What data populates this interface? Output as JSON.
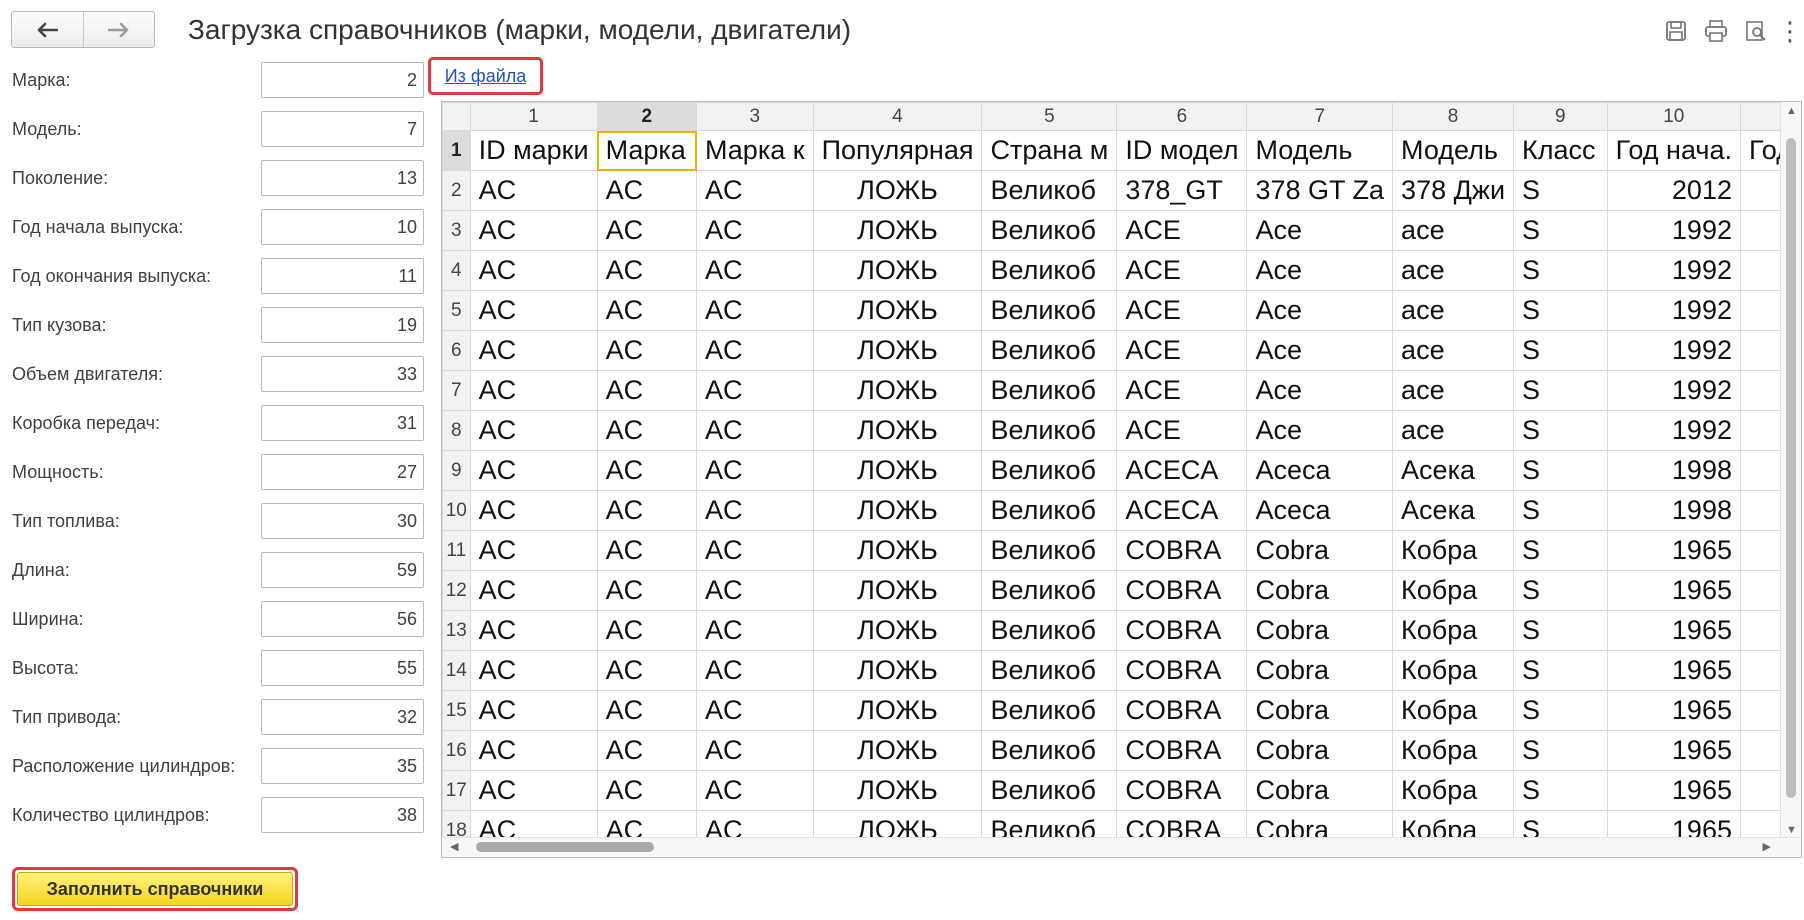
{
  "window": {
    "title": "Загрузка справочников (марки, модели, двигатели)"
  },
  "nav": {
    "back_icon": "arrow-left-icon",
    "forward_icon": "arrow-right-icon"
  },
  "toolbar": {
    "icons": [
      "save-icon",
      "print-icon",
      "preview-icon",
      "more-icon"
    ],
    "more_label": "⋮"
  },
  "fields": [
    {
      "label": "Марка:",
      "value": "2"
    },
    {
      "label": "Модель:",
      "value": "7"
    },
    {
      "label": "Поколение:",
      "value": "13"
    },
    {
      "label": "Год начала выпуска:",
      "value": "10"
    },
    {
      "label": "Год окончания выпуска:",
      "value": "11"
    },
    {
      "label": "Тип кузова:",
      "value": "19"
    },
    {
      "label": "Объем двигателя:",
      "value": "33"
    },
    {
      "label": "Коробка передач:",
      "value": "31"
    },
    {
      "label": "Мощность:",
      "value": "27"
    },
    {
      "label": "Тип топлива:",
      "value": "30"
    },
    {
      "label": "Длина:",
      "value": "59"
    },
    {
      "label": "Ширина:",
      "value": "56"
    },
    {
      "label": "Высота:",
      "value": "55"
    },
    {
      "label": "Тип привода:",
      "value": "32"
    },
    {
      "label": "Расположение цилиндров:",
      "value": "35"
    },
    {
      "label": "Количество цилиндров:",
      "value": "38"
    }
  ],
  "links": {
    "from_file": "Из файла"
  },
  "buttons": {
    "fill": "Заполнить справочники"
  },
  "sheet": {
    "column_numbers": [
      "1",
      "2",
      "3",
      "4",
      "5",
      "6",
      "7",
      "8",
      "9",
      "10",
      ""
    ],
    "rows": [
      {
        "n": "1",
        "cells": [
          "ID марки",
          "Марка",
          "Марка к",
          "Популярная",
          "Страна м",
          "ID модел",
          "Модель",
          "Модель",
          "Класс",
          "Год нача.",
          "Год"
        ]
      },
      {
        "n": "2",
        "cells": [
          "AC",
          "AC",
          "AC",
          "ЛОЖЬ",
          "Великоб",
          "378_GT",
          "378 GT Za",
          "378 Джи",
          "S",
          "2012",
          ""
        ]
      },
      {
        "n": "3",
        "cells": [
          "AC",
          "AC",
          "AC",
          "ЛОЖЬ",
          "Великоб",
          "ACE",
          "Ace",
          "асе",
          "S",
          "1992",
          ""
        ]
      },
      {
        "n": "4",
        "cells": [
          "AC",
          "AC",
          "AC",
          "ЛОЖЬ",
          "Великоб",
          "ACE",
          "Ace",
          "асе",
          "S",
          "1992",
          ""
        ]
      },
      {
        "n": "5",
        "cells": [
          "AC",
          "AC",
          "AC",
          "ЛОЖЬ",
          "Великоб",
          "ACE",
          "Ace",
          "асе",
          "S",
          "1992",
          ""
        ]
      },
      {
        "n": "6",
        "cells": [
          "AC",
          "AC",
          "AC",
          "ЛОЖЬ",
          "Великоб",
          "ACE",
          "Ace",
          "асе",
          "S",
          "1992",
          ""
        ]
      },
      {
        "n": "7",
        "cells": [
          "AC",
          "AC",
          "AC",
          "ЛОЖЬ",
          "Великоб",
          "ACE",
          "Ace",
          "асе",
          "S",
          "1992",
          ""
        ]
      },
      {
        "n": "8",
        "cells": [
          "AC",
          "AC",
          "AC",
          "ЛОЖЬ",
          "Великоб",
          "ACE",
          "Ace",
          "асе",
          "S",
          "1992",
          ""
        ]
      },
      {
        "n": "9",
        "cells": [
          "AC",
          "AC",
          "AC",
          "ЛОЖЬ",
          "Великоб",
          "ACECA",
          "Aceca",
          "Асека",
          "S",
          "1998",
          ""
        ]
      },
      {
        "n": "10",
        "cells": [
          "AC",
          "AC",
          "AC",
          "ЛОЖЬ",
          "Великоб",
          "ACECA",
          "Aceca",
          "Асека",
          "S",
          "1998",
          ""
        ]
      },
      {
        "n": "11",
        "cells": [
          "AC",
          "AC",
          "AC",
          "ЛОЖЬ",
          "Великоб",
          "COBRA",
          "Cobra",
          "Кобра",
          "S",
          "1965",
          ""
        ]
      },
      {
        "n": "12",
        "cells": [
          "AC",
          "AC",
          "AC",
          "ЛОЖЬ",
          "Великоб",
          "COBRA",
          "Cobra",
          "Кобра",
          "S",
          "1965",
          ""
        ]
      },
      {
        "n": "13",
        "cells": [
          "AC",
          "AC",
          "AC",
          "ЛОЖЬ",
          "Великоб",
          "COBRA",
          "Cobra",
          "Кобра",
          "S",
          "1965",
          ""
        ]
      },
      {
        "n": "14",
        "cells": [
          "AC",
          "AC",
          "AC",
          "ЛОЖЬ",
          "Великоб",
          "COBRA",
          "Cobra",
          "Кобра",
          "S",
          "1965",
          ""
        ]
      },
      {
        "n": "15",
        "cells": [
          "AC",
          "AC",
          "AC",
          "ЛОЖЬ",
          "Великоб",
          "COBRA",
          "Cobra",
          "Кобра",
          "S",
          "1965",
          ""
        ]
      },
      {
        "n": "16",
        "cells": [
          "AC",
          "AC",
          "AC",
          "ЛОЖЬ",
          "Великоб",
          "COBRA",
          "Cobra",
          "Кобра",
          "S",
          "1965",
          ""
        ]
      },
      {
        "n": "17",
        "cells": [
          "AC",
          "AC",
          "AC",
          "ЛОЖЬ",
          "Великоб",
          "COBRA",
          "Cobra",
          "Кобра",
          "S",
          "1965",
          ""
        ]
      },
      {
        "n": "18",
        "cells": [
          "AC",
          "AC",
          "AC",
          "ЛОЖЬ",
          "Великоб",
          "COBRA",
          "Cobra",
          "Кобра",
          "S",
          "1965",
          ""
        ]
      }
    ]
  },
  "colors": {
    "highlight_border": "#e0383e",
    "link": "#1f50c7",
    "button_yellow": "#f4d41f"
  }
}
